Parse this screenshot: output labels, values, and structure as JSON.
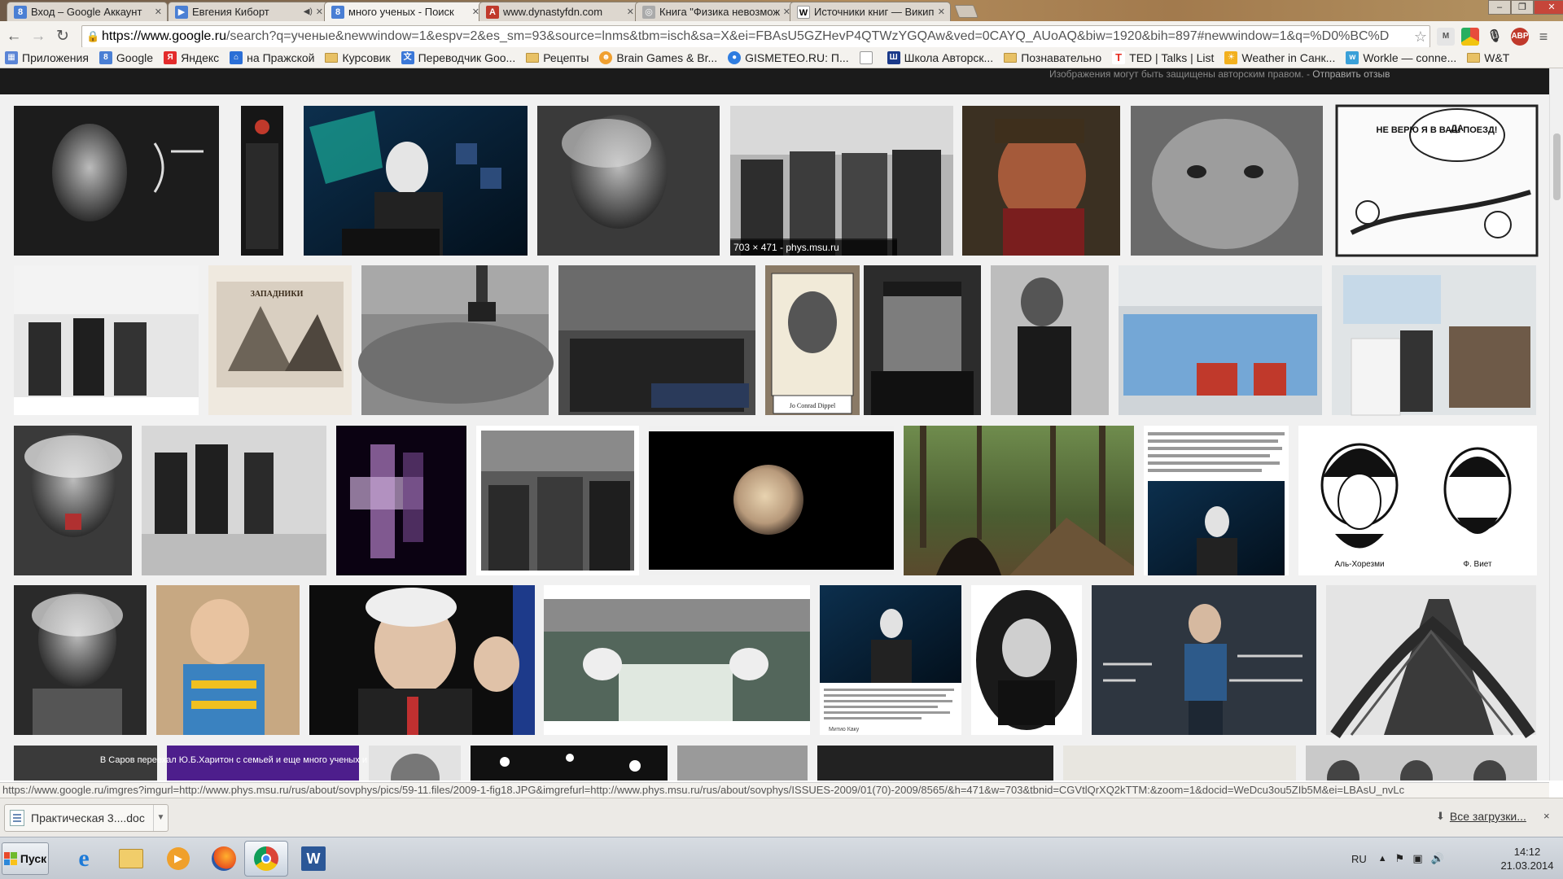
{
  "tabs": [
    {
      "label": "Вход – Google Аккаунт",
      "favicon": "google-icon",
      "color": "#4a7fd4",
      "letter": "8",
      "active": false
    },
    {
      "label": "Евгения Киборт",
      "favicon": "page-icon",
      "color": "#4a7fd4",
      "letter": "▶",
      "active": false,
      "muted": true
    },
    {
      "label": "много ученых - Поиск",
      "favicon": "google-icon",
      "color": "#4a7fd4",
      "letter": "8",
      "active": true
    },
    {
      "label": "www.dynastyfdn.com",
      "favicon": "pdf-icon",
      "color": "#c0392b",
      "letter": "A",
      "active": false
    },
    {
      "label": "Книга \"Физика невозможного\"",
      "favicon": "book-icon",
      "color": "#888",
      "letter": "◎",
      "active": false
    },
    {
      "label": "Источники книг — Википедия",
      "favicon": "wikipedia-icon",
      "color": "#fff",
      "letter": "W",
      "active": false
    }
  ],
  "url": {
    "host": "https://www.google.ru",
    "path": "/search?q=ученые&newwindow=1&espv=2&es_sm=93&source=lnms&tbm=isch&sa=X&ei=FBAsU5GZHevP4QTWzYGQAw&ved=0CAYQ_AUoAQ&biw=1920&bih=897#newwindow=1&q=%D0%BC%D"
  },
  "bookmarks": [
    {
      "label": "Приложения",
      "icon": "apps-icon",
      "color": "#5b85d6"
    },
    {
      "label": "Google",
      "icon": "google-icon",
      "color": "#4a7fd4"
    },
    {
      "label": "Яндекс",
      "icon": "yandex-icon",
      "color": "#e32b2b"
    },
    {
      "label": "на Пражской",
      "icon": "house-icon",
      "color": "#2b6fd6"
    },
    {
      "label": "Курсовик",
      "icon": "folder-icon"
    },
    {
      "label": "Переводчик Goo...",
      "icon": "translate-icon",
      "color": "#3b78d8"
    },
    {
      "label": "Рецепты",
      "icon": "folder-icon"
    },
    {
      "label": "Brain Games & Br...",
      "icon": "brain-icon",
      "color": "#f0a030"
    },
    {
      "label": "GISMETEO.RU: П...",
      "icon": "weather-icon",
      "color": "#2f7de0"
    },
    {
      "label": "",
      "icon": "page-icon",
      "color": "#ddd"
    },
    {
      "label": "Школа Авторск...",
      "icon": "school-icon",
      "color": "#1b3a8a"
    },
    {
      "label": "Познавательно",
      "icon": "folder-icon"
    },
    {
      "label": "TED | Talks | List",
      "icon": "ted-icon",
      "color": "#e62b1e"
    },
    {
      "label": "Weather in Санк...",
      "icon": "weather-icon",
      "color": "#f2b01e"
    },
    {
      "label": "Workle — conne...",
      "icon": "workle-icon",
      "color": "#3aa0d8"
    },
    {
      "label": "W&T",
      "icon": "folder-icon"
    }
  ],
  "google_bar": {
    "notice": "Изображения могут быть защищены авторским правом.",
    "separator": "-",
    "feedback": "Отправить отзыв"
  },
  "hover_overlay": "703 × 471 - phys.msu.ru",
  "status_url": "https://www.google.ru/imgres?imgurl=http://www.phys.msu.ru/rus/about/sovphys/pics/59-11.files/2009-1-fig18.JPG&imgrefurl=http://www.phys.msu.ru/rus/about/sovphys/ISSUES-2009/01(70)-2009/8565/&h=471&w=703&tbnid=CGVtlQrXQ2kTTM:&zoom=1&docid=WeDcu3ou5ZIb5M&ei=LBAsU_nvLc",
  "downloads": {
    "item": "Практическая 3....doc",
    "all": "Все загрузки...",
    "close": "×"
  },
  "taskbar": {
    "start": "Пуск",
    "lang": "RU",
    "time": "14:12",
    "date": "21.03.2014",
    "apps": [
      "ie-icon",
      "explorer-icon",
      "media-player-icon",
      "firefox-icon",
      "chrome-icon",
      "word-icon"
    ]
  },
  "thumb_texts": {
    "t_cartoon": "НЕ ВЕРЮ Я В ВАШ ПОЕЗД!",
    "t_cartoon_top": "ДА",
    "t_portrait_left": "Аль-Хорезми",
    "t_portrait_right": "Ф. Виет",
    "t_conrad": "Jo Conrad Dippel",
    "t_newspaper": "ЗАПАДНИКИ",
    "t_saratov": "В Саров переехал Ю.Б.Харитон с семьей и еще много ученых и математиков.",
    "t_article_author": "Митио Каку"
  }
}
